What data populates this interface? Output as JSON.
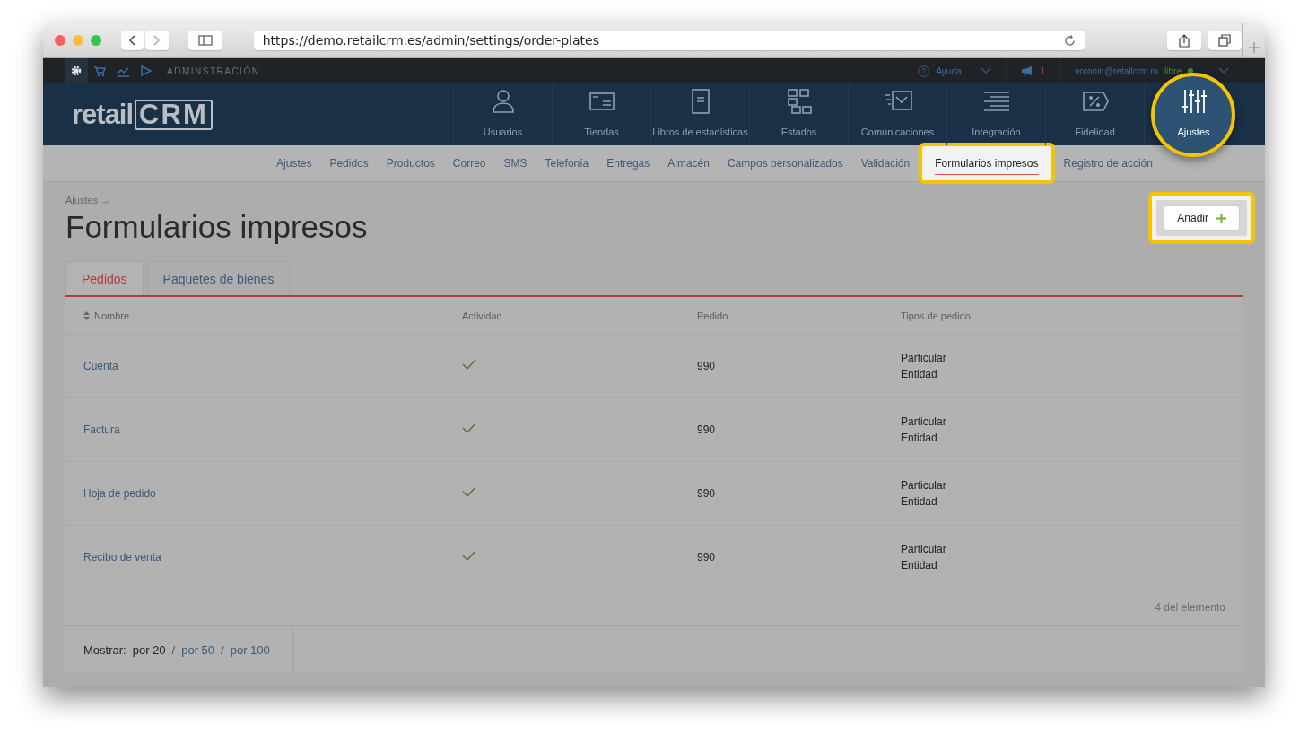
{
  "browser": {
    "url": "https://demo.retailcrm.es/admin/settings/order-plates"
  },
  "topbar": {
    "icons": [
      {
        "kind": "gear",
        "selected": true
      },
      {
        "kind": "cart",
        "selected": false
      },
      {
        "kind": "chart",
        "selected": false
      },
      {
        "kind": "play",
        "selected": false
      }
    ],
    "section": "ADMINSTRACIÓN",
    "help": "Ayuda",
    "notifications": "1",
    "user": "voronin@retailcrm.ru",
    "plan": "libre"
  },
  "logo": {
    "text_1": "retail",
    "text_2": "CRM"
  },
  "nav": [
    {
      "label": "Usuarios",
      "kind": "user",
      "selected": false
    },
    {
      "label": "Tiendas",
      "kind": "store",
      "selected": false
    },
    {
      "label": "Libros de estadísticas",
      "kind": "book",
      "selected": false
    },
    {
      "label": "Estados",
      "kind": "grid",
      "selected": false
    },
    {
      "label": "Comunicaciones",
      "kind": "mail",
      "selected": false
    },
    {
      "label": "Integración",
      "kind": "lines",
      "selected": false
    },
    {
      "label": "Fidelidad",
      "kind": "percent",
      "selected": false
    },
    {
      "label": "Ajustes",
      "kind": "sliders",
      "selected": true
    }
  ],
  "subnav": [
    {
      "label": "Ajustes",
      "selected": false
    },
    {
      "label": "Pedidos",
      "selected": false
    },
    {
      "label": "Productos",
      "selected": false
    },
    {
      "label": "Correo",
      "selected": false
    },
    {
      "label": "SMS",
      "selected": false
    },
    {
      "label": "Telefonía",
      "selected": false
    },
    {
      "label": "Entregas",
      "selected": false
    },
    {
      "label": "Almacén",
      "selected": false
    },
    {
      "label": "Campos personalizados",
      "selected": false
    },
    {
      "label": "Validación",
      "selected": false
    },
    {
      "label": "Formularios impresos",
      "selected": true
    },
    {
      "label": "Registro de acción",
      "selected": false
    }
  ],
  "breadcrumb": "Ajustes →",
  "title": "Formularios impresos",
  "add_button": "Añadir",
  "tabs": [
    {
      "label": "Pedidos",
      "selected": true
    },
    {
      "label": "Paquetes de bienes",
      "selected": false
    }
  ],
  "table": {
    "columns": [
      "Nombre",
      "Actividad",
      "Pedido",
      "Tipos de pedido"
    ],
    "rows": [
      {
        "name": "Cuenta",
        "active": true,
        "order": "990",
        "types": [
          "Particular",
          "Entidad"
        ]
      },
      {
        "name": "Factura",
        "active": true,
        "order": "990",
        "types": [
          "Particular",
          "Entidad"
        ]
      },
      {
        "name": "Hoja de pedido",
        "active": true,
        "order": "990",
        "types": [
          "Particular",
          "Entidad"
        ]
      },
      {
        "name": "Recibo de venta",
        "active": true,
        "order": "990",
        "types": [
          "Particular",
          "Entidad"
        ]
      }
    ],
    "count": "4 del elemento"
  },
  "pagination": {
    "label": "Mostrar:",
    "options": [
      {
        "label": "por 20",
        "selected": true
      },
      {
        "label": "por 50",
        "selected": false
      },
      {
        "label": "por 100",
        "selected": false
      }
    ],
    "separator": "/"
  }
}
